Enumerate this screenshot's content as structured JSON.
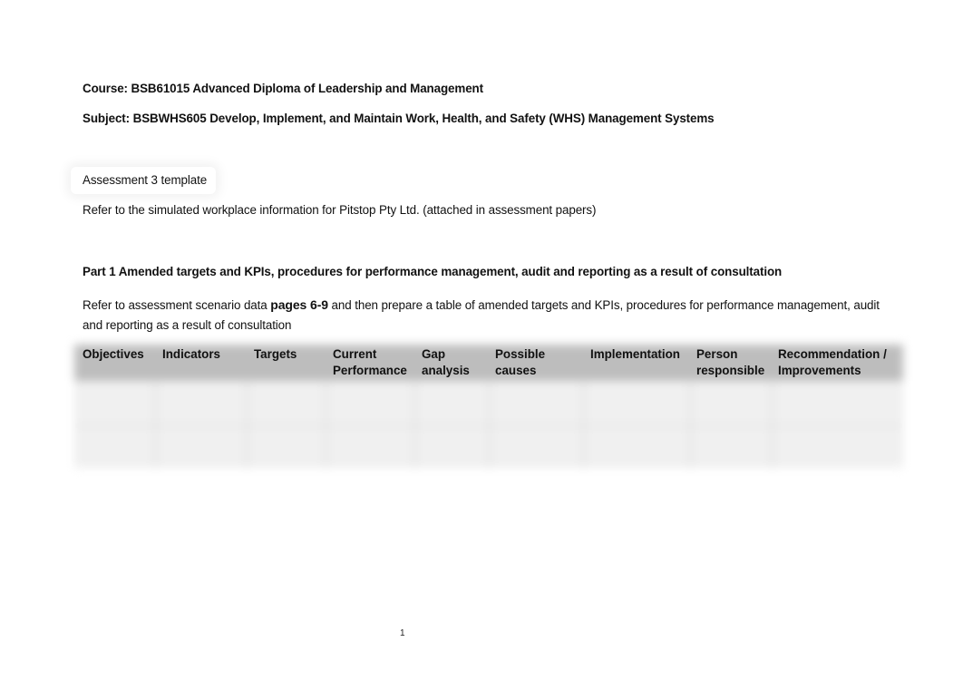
{
  "document": {
    "course": "Course: BSB61015 Advanced Diploma of Leadership and Management",
    "subject": "Subject: BSBWHS605 Develop, Implement, and Maintain Work, Health, and Safety (WHS) Management Systems",
    "assessment_label": "Assessment 3 template",
    "refer_line": "Refer to the simulated workplace information for Pitstop Pty Ltd. (attached in assessment papers)",
    "part1_heading": "Part 1 Amended targets and KPIs, procedures for performance management, audit and reporting as a result of consultation",
    "instruction": {
      "before": "Refer to assessment scenario data ",
      "bold": "pages 6-9",
      "after": " and then prepare a table of amended targets and KPIs, procedures for performance management, audit and reporting as a result of consultation"
    },
    "table": {
      "headers": [
        "Objectives",
        "Indicators",
        "Targets",
        "Current\nPerformance",
        "Gap\nanalysis",
        "Possible\ncauses",
        "Implementation",
        "Person\nresponsible",
        "Recommendation /\nImprovements"
      ],
      "rows": [
        [
          "",
          "",
          "",
          "",
          "",
          "",
          "",
          "",
          ""
        ],
        [
          "",
          "",
          "",
          "",
          "",
          "",
          "",
          "",
          ""
        ]
      ]
    },
    "page_number": "1"
  }
}
